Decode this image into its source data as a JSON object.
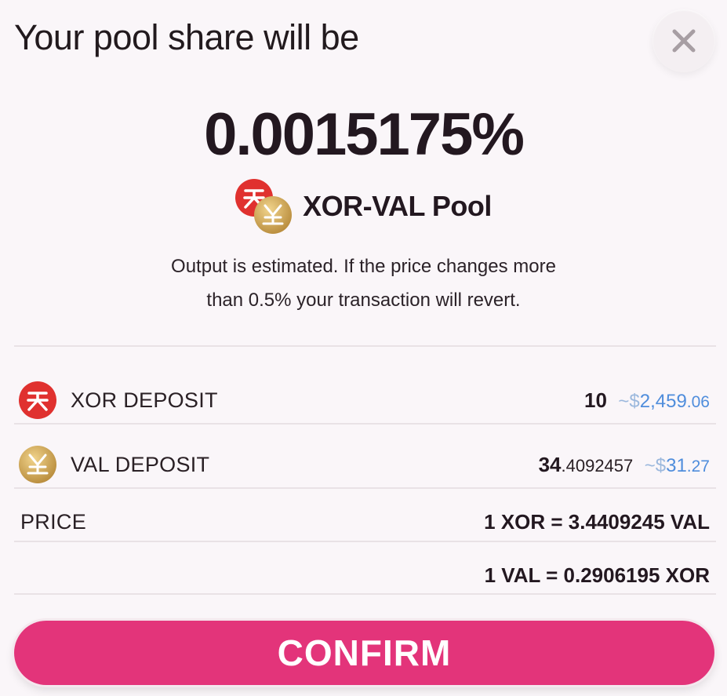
{
  "dialog": {
    "title": "Your pool share will be",
    "close_icon": "close-icon"
  },
  "share": {
    "value": "0.0015175%",
    "pool_name": "XOR-VAL Pool"
  },
  "note": {
    "line1": "Output is estimated. If the price changes more",
    "line2": "than 0.5% your transaction will revert."
  },
  "deposits": [
    {
      "label": "XOR DEPOSIT",
      "amount_int": "10",
      "amount_dec": "",
      "fiat_prefix": "~$",
      "fiat_int": "2,459",
      "fiat_dec": ".06",
      "icon": "xor-token-icon"
    },
    {
      "label": "VAL DEPOSIT",
      "amount_int": "34",
      "amount_dec": ".4092457",
      "fiat_prefix": "~$",
      "fiat_int": "31",
      "fiat_dec": ".27",
      "icon": "val-token-icon"
    }
  ],
  "price": {
    "label": "PRICE",
    "xor_to_val": "1 XOR = 3.4409245 VAL",
    "val_to_xor": "1 VAL = 0.2906195 XOR"
  },
  "confirm_label": "CONFIRM",
  "colors": {
    "accent": "#e3347a",
    "fiat": "#4f8ddc",
    "xor_red": "#e0312f",
    "val_gold": "#c9a04e"
  }
}
